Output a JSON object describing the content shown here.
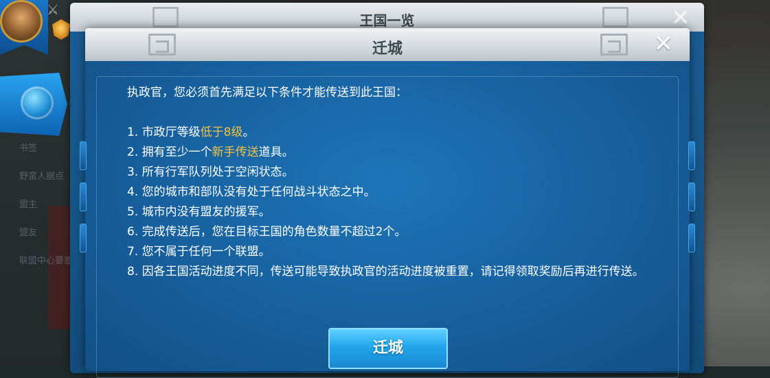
{
  "back_dialog": {
    "title": "王国一览",
    "close": "✕"
  },
  "dialog": {
    "title": "迁城",
    "close": "✕",
    "intro": "执政官，您必须首先满足以下条件才能传送到此王国：",
    "rules": [
      {
        "parts": [
          {
            "t": "1. 市政厅等级"
          },
          {
            "t": "低于8级",
            "hl": true
          },
          {
            "t": "。"
          }
        ]
      },
      {
        "parts": [
          {
            "t": "2. 拥有至少一个"
          },
          {
            "t": "新手传送",
            "hl": true
          },
          {
            "t": "道具。"
          }
        ]
      },
      {
        "parts": [
          {
            "t": "3. 所有行军队列处于空闲状态。"
          }
        ]
      },
      {
        "parts": [
          {
            "t": "4. 您的城市和部队没有处于任何战斗状态之中。"
          }
        ]
      },
      {
        "parts": [
          {
            "t": "5. 城市内没有盟友的援军。"
          }
        ]
      },
      {
        "parts": [
          {
            "t": "6. 完成传送后，您在目标王国的角色数量不超过2个。"
          }
        ]
      },
      {
        "parts": [
          {
            "t": "7. 您不属于任何一个联盟。"
          }
        ]
      },
      {
        "parts": [
          {
            "t": "8. 因各王国活动进度不同，传送可能导致执政官的活动进度被重置，请记得领取奖励后再进行传送。"
          }
        ]
      }
    ],
    "button_label": "迁城"
  },
  "sidebar": {
    "items": [
      "书签",
      "野蛮人据点",
      "盟主",
      "盟友",
      "联盟中心要塞"
    ]
  },
  "colors": {
    "highlight": "#f4c242",
    "button": "#22a6ec",
    "panel": "#17609e"
  }
}
